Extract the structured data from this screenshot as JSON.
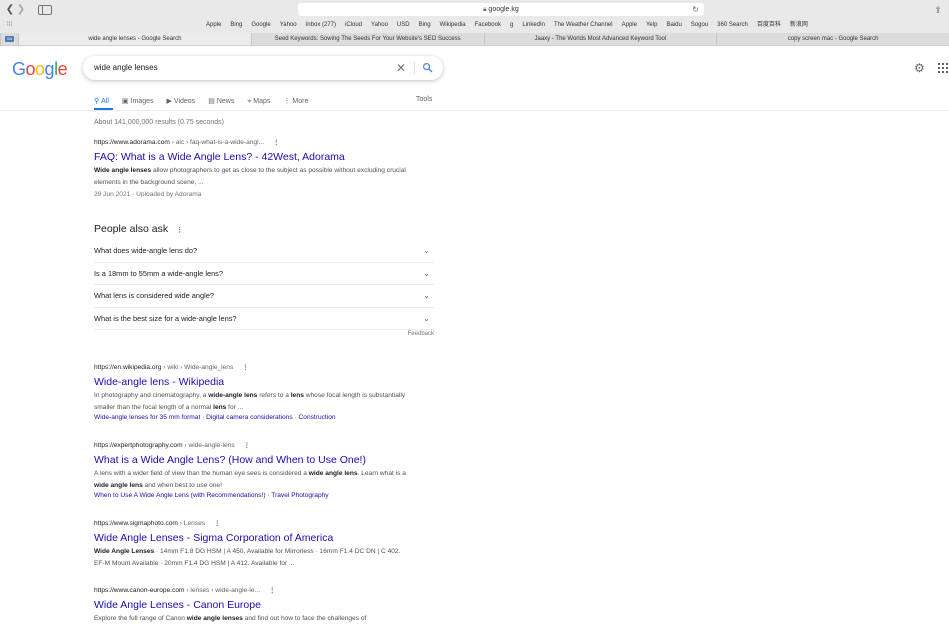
{
  "browser": {
    "address": "google.kg",
    "bookmarks": [
      "Apple",
      "Bing",
      "Google",
      "Yahoo",
      "Inbox (277)",
      "iCloud",
      "Yahoo",
      "USD",
      "Bing",
      "Wikipedia",
      "Facebook",
      "g",
      "LinkedIn",
      "The Weather Channel",
      "Apple",
      "Yelp",
      "Baidu",
      "Sogou",
      "360 Search",
      "百度百科",
      "新浪网"
    ],
    "tabs": [
      "wide angle lenses - Google Search",
      "Seed Keywords: Sowing The Seeds For Your Website's SEO Success",
      "Jaaxy - The Worlds Most Advanced Keyword Tool",
      "copy screen mac - Google Search"
    ],
    "tab_favicon": "SA"
  },
  "google": {
    "logo": "Google",
    "query": "wide angle lenses",
    "nav": [
      {
        "icon": "search-icon",
        "glyph": "⚲",
        "label": "All"
      },
      {
        "icon": "image-icon",
        "glyph": "▣",
        "label": "Images"
      },
      {
        "icon": "video-icon",
        "glyph": "▶",
        "label": "Videos"
      },
      {
        "icon": "news-icon",
        "glyph": "▤",
        "label": "News"
      },
      {
        "icon": "map-pin-icon",
        "glyph": "⌖",
        "label": "Maps"
      },
      {
        "icon": "more-icon",
        "glyph": "⋮",
        "label": "More"
      }
    ],
    "tools": "Tools",
    "stats": "About 141,000,000 results (0.75 seconds)"
  },
  "results": [
    {
      "url": "https://www.adorama.com",
      "crumb": " › alc › faq-what-is-a-wide-angl...",
      "title": "FAQ: What is a Wide Angle Lens? - 42West, Adorama",
      "snippet_html": "<b>Wide angle lenses</b> allow photographers to get as close to the subject as possible without excluding crucial elements in the background scene, ...",
      "date": "29 Jun 2021 · Uploaded by Adorama"
    },
    {
      "url": "https://en.wikipedia.org",
      "crumb": " › wiki › Wide-angle_lens",
      "title": "Wide-angle lens - Wikipedia",
      "snippet_html": "In photography and cinematography, a <b>wide-angle lens</b> refers to a <b>lens</b> whose focal length is substantially smaller than the focal length of a normal <b>lens</b> for ...",
      "links": [
        "Wide-angle lenses for 35 mm format",
        "Digital camera considerations",
        "Construction"
      ]
    },
    {
      "url": "https://expertphotography.com",
      "crumb": " › wide-angle-lens",
      "title": "What is a Wide Angle Lens? (How and When to Use One!)",
      "snippet_html": "A lens with a wider field of view than the human eye sees is considered a <b>wide angle lens</b>. Learn what is a <b>wide angle lens</b> and when best to use one!",
      "links": [
        "When to Use A Wide Angle Lens (with Recommendations!)",
        "Travel Photography"
      ]
    },
    {
      "url": "https://www.sigmaphoto.com",
      "crumb": " › Lenses",
      "title": "Wide Angle Lenses - Sigma Corporation of America",
      "snippet_html": "<b>Wide Angle Lenses</b> · 14mm F1.8 DG HSM | A 450. Available for Mirrorless · 16mm F1.4 DC DN | C 402. EF-M Mount Available · 20mm F1.4 DG HSM | A 412. Available for ..."
    },
    {
      "url": "https://www.canon-europe.com",
      "crumb": " › lenses › wide-angle-le...",
      "title": "Wide Angle Lenses - Canon Europe",
      "snippet_html": "Explore the full range of Canon <b>wide angle lenses</b> and find out how to face the challenges of"
    }
  ],
  "people_also_ask": {
    "title": "People also ask",
    "questions": [
      "What does wide-angle lens do?",
      "Is a 18mm to 55mm a wide-angle lens?",
      "What lens is considered wide angle?",
      "What is the best size for a wide-angle lens?"
    ],
    "feedback": "Feedback"
  },
  "colors": {
    "link": "#1a0dab",
    "accent": "#1a73e8",
    "text": "#202124",
    "muted": "#70757a"
  }
}
